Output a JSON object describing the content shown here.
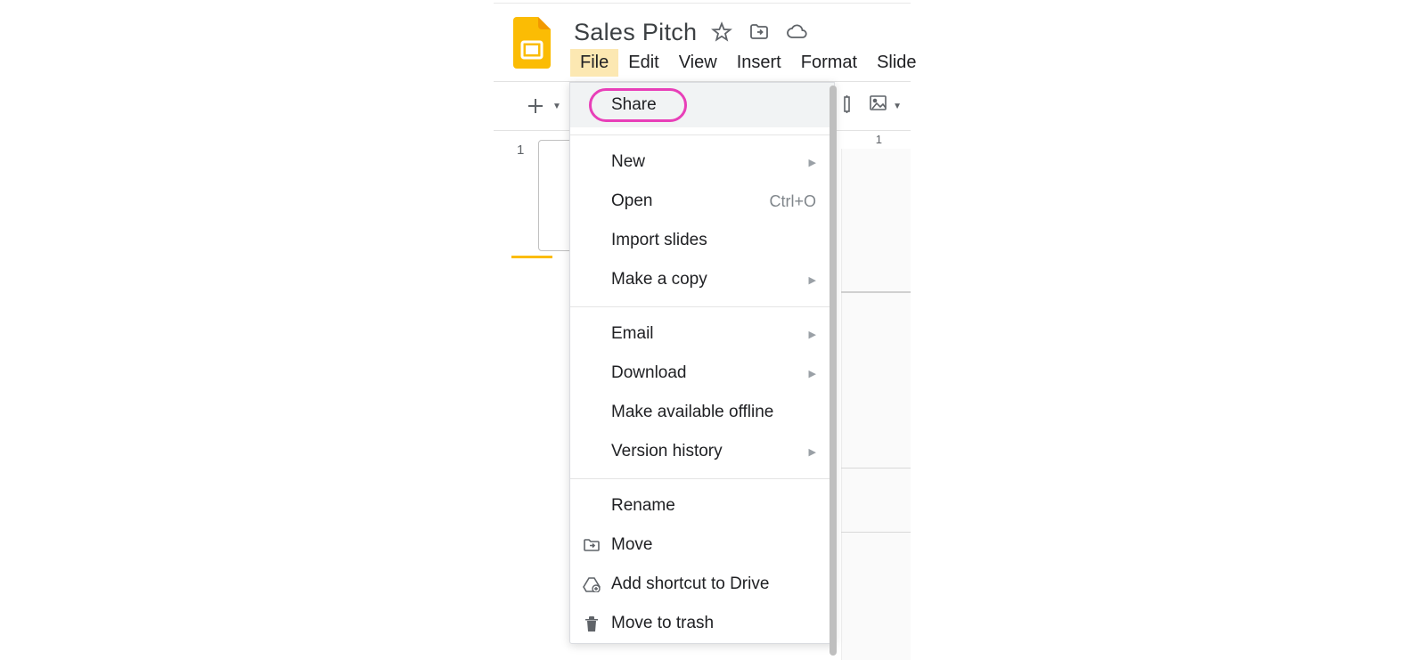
{
  "doc": {
    "title": "Sales Pitch"
  },
  "menubar": {
    "items": [
      "File",
      "Edit",
      "View",
      "Insert",
      "Format",
      "Slide"
    ],
    "active": "File"
  },
  "toolbar": {
    "new": "+"
  },
  "ruler": {
    "mark": "1"
  },
  "slidepanel": {
    "num": "1"
  },
  "menu": {
    "share": "Share",
    "new": "New",
    "open": "Open",
    "open_shortcut": "Ctrl+O",
    "import": "Import slides",
    "copy": "Make a copy",
    "email": "Email",
    "download": "Download",
    "offline": "Make available offline",
    "history": "Version history",
    "rename": "Rename",
    "move": "Move",
    "shortcut": "Add shortcut to Drive",
    "trash": "Move to trash"
  }
}
